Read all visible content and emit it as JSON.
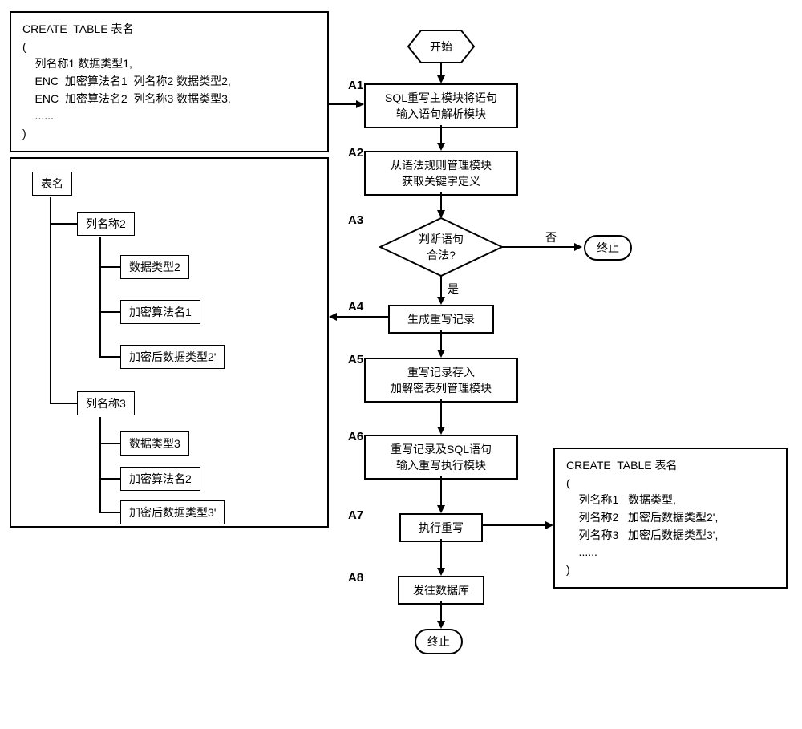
{
  "flow": {
    "start": "开始",
    "a1": {
      "label": "A1",
      "line1": "SQL重写主模块将语句",
      "line2": "输入语句解析模块"
    },
    "a2": {
      "label": "A2",
      "line1": "从语法规则管理模块",
      "line2": "获取关键字定义"
    },
    "a3": {
      "label": "A3",
      "line1": "判断语句",
      "line2": "合法?",
      "yes": "是",
      "no": "否"
    },
    "a4": {
      "label": "A4",
      "text": "生成重写记录"
    },
    "a5": {
      "label": "A5",
      "line1": "重写记录存入",
      "line2": "加解密表列管理模块"
    },
    "a6": {
      "label": "A6",
      "line1": "重写记录及SQL语句",
      "line2": "输入重写执行模块"
    },
    "a7": {
      "label": "A7",
      "text": "执行重写"
    },
    "a8": {
      "label": "A8",
      "text": "发往数据库"
    },
    "end": "终止"
  },
  "code_in": {
    "l1": "CREATE  TABLE 表名",
    "l2": "(",
    "l3": "    列名称1 数据类型1,",
    "l4": "    ENC  加密算法名1  列名称2 数据类型2,",
    "l5": "    ENC  加密算法名2  列名称3 数据类型3,",
    "l6": "    ......",
    "l7": ")"
  },
  "tree": {
    "root": "表名",
    "col2": "列名称2",
    "col2_dt": "数据类型2",
    "col2_alg": "加密算法名1",
    "col2_enc": "加密后数据类型2'",
    "col3": "列名称3",
    "col3_dt": "数据类型3",
    "col3_alg": "加密算法名2",
    "col3_enc": "加密后数据类型3'"
  },
  "code_out": {
    "l1": "CREATE  TABLE 表名",
    "l2": "(",
    "l3": "    列名称1   数据类型,",
    "l4": "    列名称2   加密后数据类型2',",
    "l5": "    列名称3   加密后数据类型3',",
    "l6": "    ......",
    "l7": ")"
  }
}
